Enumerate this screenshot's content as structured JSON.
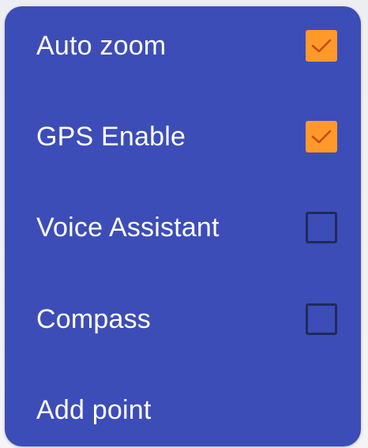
{
  "menu": {
    "items": [
      {
        "label": "Auto zoom",
        "checked": true,
        "has_checkbox": true
      },
      {
        "label": "GPS Enable",
        "checked": true,
        "has_checkbox": true
      },
      {
        "label": "Voice Assistant",
        "checked": false,
        "has_checkbox": true
      },
      {
        "label": "Compass",
        "checked": false,
        "has_checkbox": true
      },
      {
        "label": "Add point",
        "has_checkbox": false
      }
    ]
  },
  "colors": {
    "menu_background": "#3d4db7",
    "checkbox_checked": "#ff9a2a",
    "checkbox_border_unchecked": "#1f2a5c",
    "label_text": "#ffffff"
  },
  "icons": {
    "checked_mark": "check-icon"
  }
}
